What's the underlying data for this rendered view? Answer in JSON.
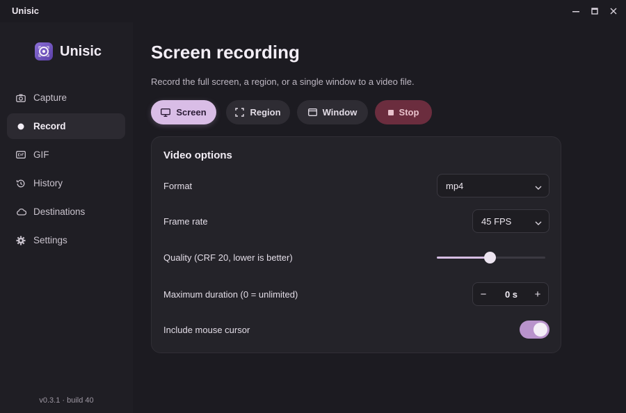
{
  "window": {
    "title": "Unisic",
    "controls": [
      "minimize-icon",
      "maximize-icon",
      "close-icon"
    ]
  },
  "sidebar": {
    "brand": "Unisic",
    "items": [
      {
        "label": "Capture",
        "icon": "camera-icon",
        "active": false
      },
      {
        "label": "Record",
        "icon": "dot-icon",
        "active": true
      },
      {
        "label": "GIF",
        "icon": "gif-icon",
        "active": false
      },
      {
        "label": "History",
        "icon": "history-icon",
        "active": false
      },
      {
        "label": "Destinations",
        "icon": "cloud-icon",
        "active": false
      },
      {
        "label": "Settings",
        "icon": "gear-icon",
        "active": false
      }
    ],
    "version": "v0.3.1 · build 40"
  },
  "main": {
    "title": "Screen recording",
    "subtitle": "Record the full screen, a region, or a single window to a video file.",
    "modes": [
      {
        "label": "Screen",
        "icon": "monitor-icon",
        "selected": true
      },
      {
        "label": "Region",
        "icon": "region-icon",
        "selected": false
      },
      {
        "label": "Window",
        "icon": "window-icon",
        "selected": false
      },
      {
        "label": "Stop",
        "icon": "stop-icon",
        "selected": false
      }
    ],
    "card": {
      "title": "Video options",
      "format": {
        "label": "Format",
        "value": "mp4"
      },
      "frame_rate": {
        "label": "Frame rate",
        "value": "45 FPS"
      },
      "quality": {
        "label": "Quality (CRF 20, lower is better)",
        "fraction": 0.49
      },
      "max_duration": {
        "label": "Maximum duration (0 = unlimited)",
        "value": "0 s",
        "minus": "−",
        "plus": "+"
      },
      "cursor": {
        "label": "Include mouse cursor",
        "on": true
      }
    }
  },
  "colors": {
    "accent": "#d9bde6",
    "stop": "#6b2d3e",
    "background": "#1c1b21",
    "sidebar": "#1f1e24",
    "card": "#242329"
  }
}
